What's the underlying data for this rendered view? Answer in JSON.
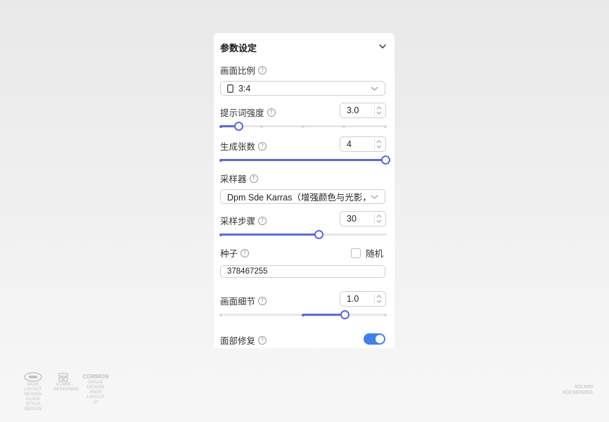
{
  "panel": {
    "title": "参数设定",
    "aspect": {
      "label": "画面比例",
      "value": "3:4"
    },
    "guidance": {
      "label": "提示词强度",
      "value": "3.0",
      "slider_fraction": 0.1
    },
    "count": {
      "label": "生成张数",
      "value": "4",
      "slider_fraction": 1.0
    },
    "sampler": {
      "label": "采样器",
      "value": "Dpm Sde Karras（增强颜色与光影，..."
    },
    "steps": {
      "label": "采样步骤",
      "value": "30",
      "slider_fraction": 0.6
    },
    "seed": {
      "label": "种子",
      "random_label": "随机",
      "value": "378467255"
    },
    "detail": {
      "label": "画面细节",
      "value": "1.0",
      "slider_low_fraction": 0.5,
      "slider_high_fraction": 0.75
    },
    "face_fix": {
      "label": "面部修复",
      "enabled": true
    }
  },
  "colors": {
    "accent": "#5b67e8",
    "toggle": "#3f7ff0"
  },
  "footer": {
    "logos": [
      {
        "icon": "ribbon-logo-icon",
        "lines": [
          "PAGE LAYOUT",
          "DESIGN GUIDE",
          "STYLE DESIGN"
        ]
      },
      {
        "icon": "grid-logo-icon",
        "lines": [
          "GLMIN",
          "DESIGNING"
        ]
      },
      {
        "icon": "text-logo",
        "lines": [
          "COMMON",
          "SPACE DESIGN",
          "PAGE LAYOUT",
          "UI"
        ]
      }
    ],
    "watermark": [
      "#GLMIN",
      "#DESIGNING"
    ]
  }
}
